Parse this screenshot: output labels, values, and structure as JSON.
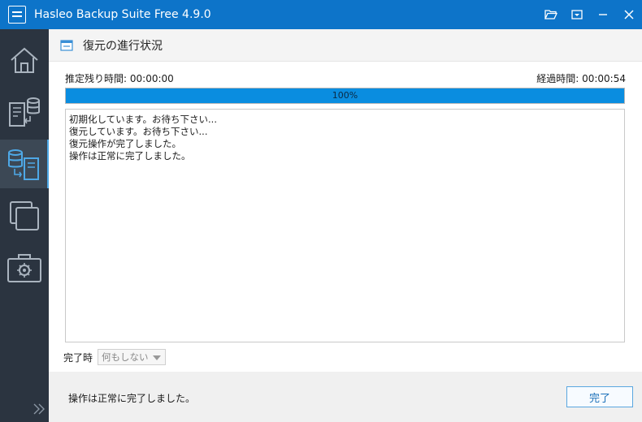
{
  "window": {
    "title": "Hasleo Backup Suite Free 4.9.0"
  },
  "titlebar_icons": [
    "folder-open-icon",
    "dropdown-menu-icon",
    "minimize-icon",
    "close-icon"
  ],
  "sidebar": {
    "items": [
      {
        "icon": "home-icon",
        "active": false
      },
      {
        "icon": "backup-icon",
        "active": false
      },
      {
        "icon": "restore-icon",
        "active": true
      },
      {
        "icon": "clone-icon",
        "active": false
      },
      {
        "icon": "tools-icon",
        "active": false
      }
    ],
    "expand_icon": "double-chevron-right-icon"
  },
  "page": {
    "title": "復元の進行状況"
  },
  "time": {
    "remaining_label": "推定残り時間:",
    "remaining_value": "00:00:00",
    "elapsed_label": "経過時間:",
    "elapsed_value": "00:00:54"
  },
  "progress": {
    "percent": 100,
    "label": "100%"
  },
  "log": {
    "lines": [
      "初期化しています。お待ち下さい...",
      "復元しています。お待ち下さい...",
      "復元操作が完了しました。",
      "操作は正常に完了しました。"
    ]
  },
  "on_complete": {
    "label": "完了時",
    "selected": "何もしない"
  },
  "footer": {
    "status": "操作は正常に完了しました。",
    "finish_label": "完了"
  },
  "colors": {
    "titlebar": "#0d74c9",
    "sidebar": "#2b3440",
    "progress": "#0a8de0",
    "accent": "#4ea8e6"
  }
}
